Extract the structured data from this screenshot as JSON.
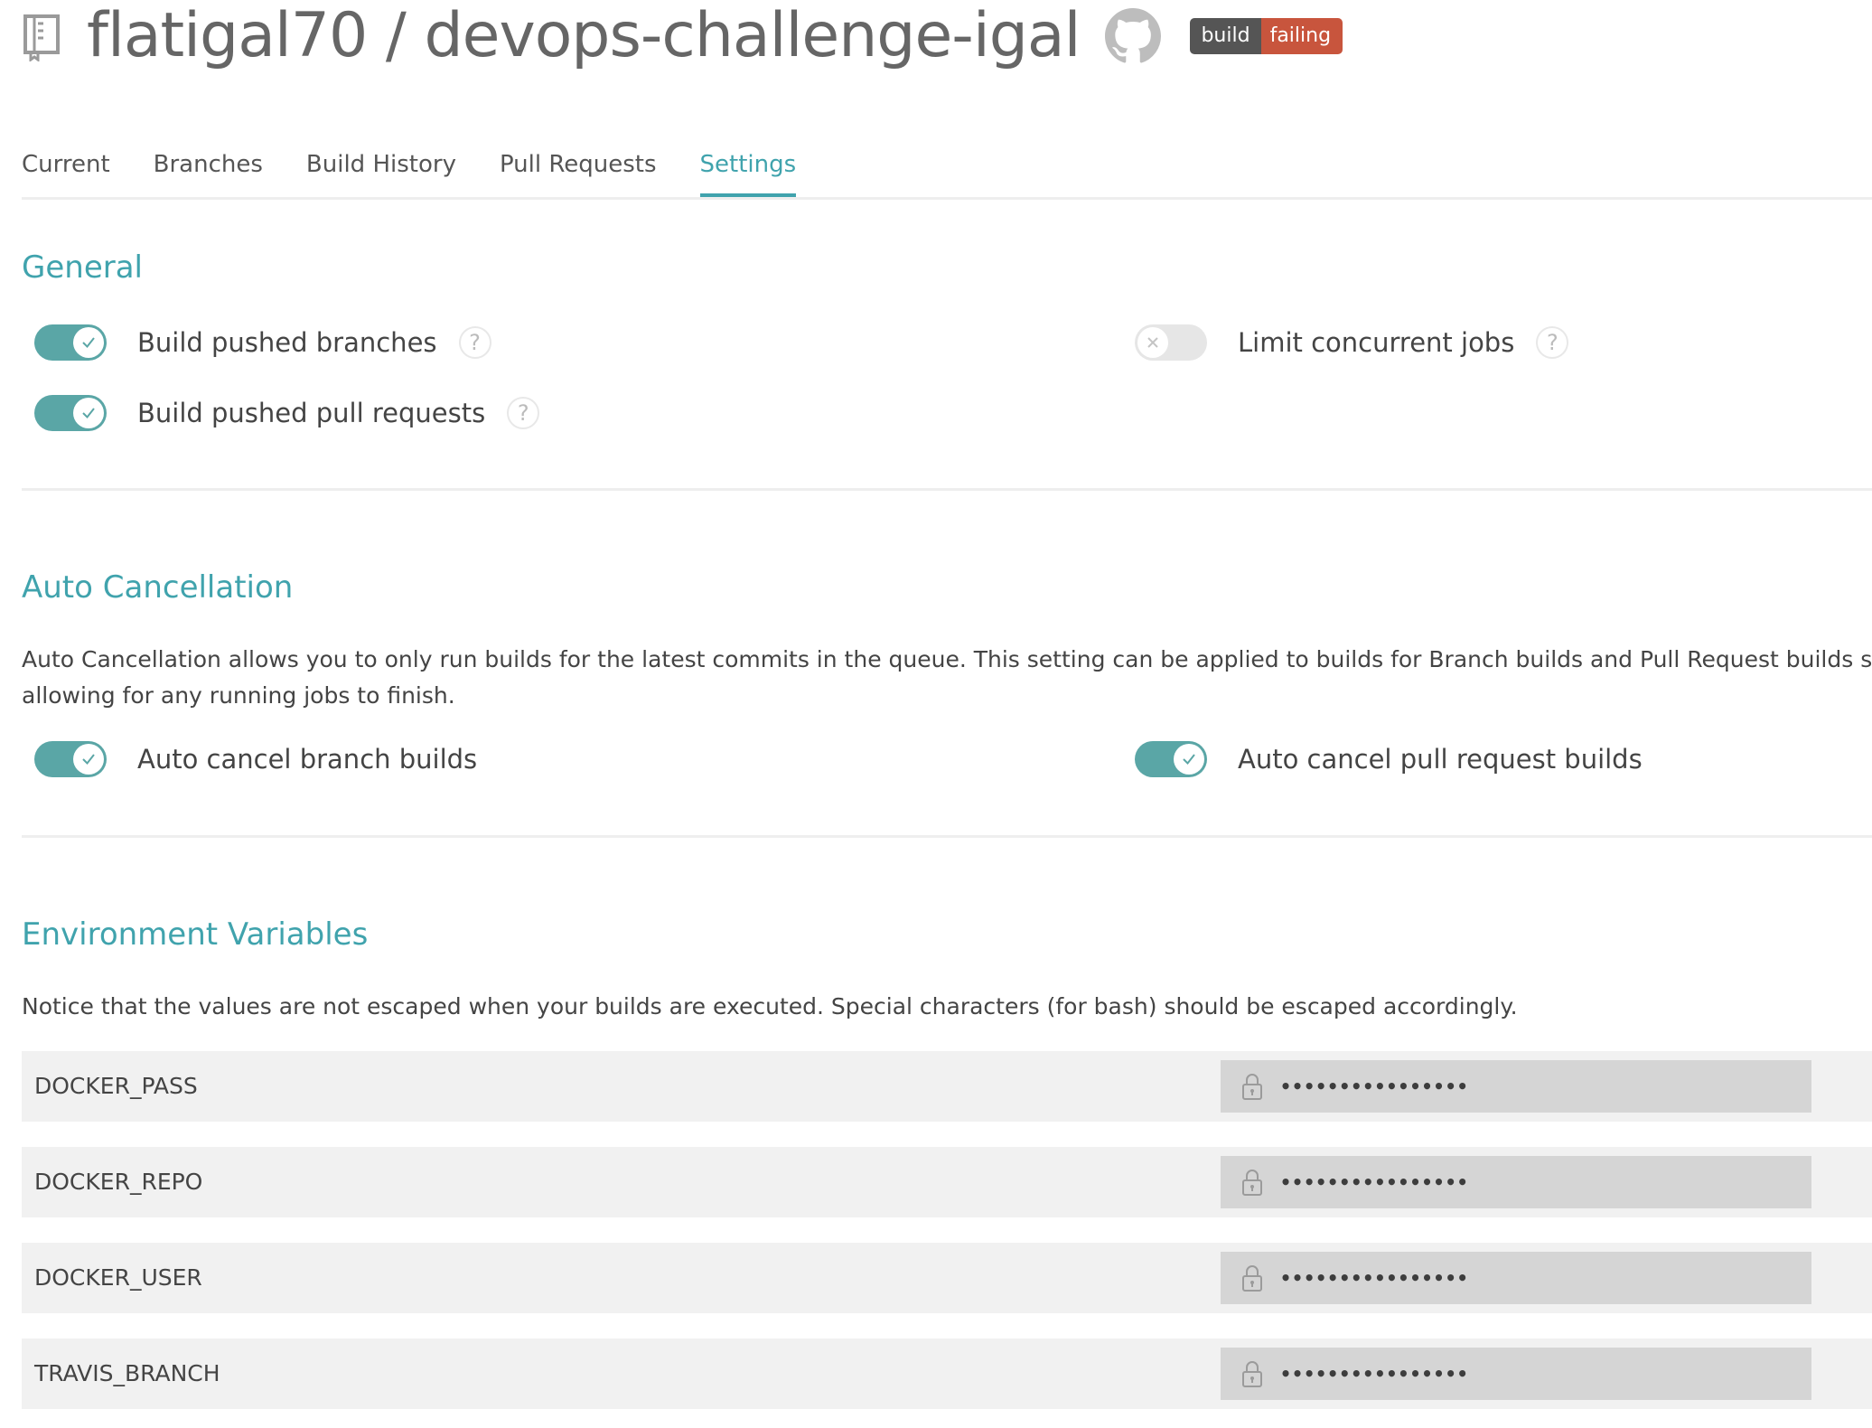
{
  "header": {
    "repo_title": "flatigal70 / devops-challenge-igal",
    "badge": {
      "left": "build",
      "right": "failing",
      "left_color": "#555555",
      "right_color": "#c8553d"
    }
  },
  "tabs": [
    {
      "label": "Current",
      "active": false
    },
    {
      "label": "Branches",
      "active": false
    },
    {
      "label": "Build History",
      "active": false
    },
    {
      "label": "Pull Requests",
      "active": false
    },
    {
      "label": "Settings",
      "active": true
    }
  ],
  "accent_color": "#40a3ad",
  "general": {
    "title": "General",
    "settings": [
      {
        "label": "Build pushed branches",
        "enabled": true,
        "help": "?"
      },
      {
        "label": "Build pushed pull requests",
        "enabled": true,
        "help": "?"
      },
      {
        "label": "Limit concurrent jobs",
        "enabled": false,
        "help": "?"
      }
    ]
  },
  "auto_cancellation": {
    "title": "Auto Cancellation",
    "description_line1": "Auto Cancellation allows you to only run builds for the latest commits in the queue. This setting can be applied to builds for Branch builds and Pull Request builds separately. Bui",
    "description_line2": "allowing for any running jobs to finish.",
    "settings": [
      {
        "label": "Auto cancel branch builds",
        "enabled": true
      },
      {
        "label": "Auto cancel pull request builds",
        "enabled": true
      }
    ]
  },
  "env_vars": {
    "title": "Environment Variables",
    "notice": "Notice that the values are not escaped when your builds are executed. Special characters (for bash) should be escaped accordingly.",
    "items": [
      {
        "name": "DOCKER_PASS",
        "value": "••••••••••••••••"
      },
      {
        "name": "DOCKER_REPO",
        "value": "••••••••••••••••"
      },
      {
        "name": "DOCKER_USER",
        "value": "••••••••••••••••"
      },
      {
        "name": "TRAVIS_BRANCH",
        "value": "••••••••••••••••"
      }
    ]
  }
}
